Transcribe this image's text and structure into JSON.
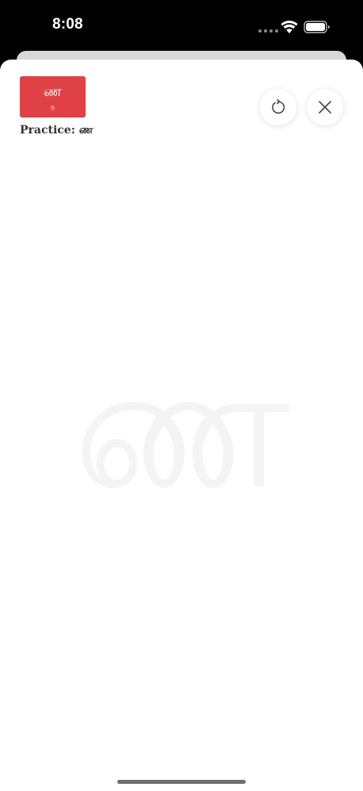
{
  "status_bar": {
    "time": "8:08",
    "icons": [
      "signal-dots-icon",
      "wifi-icon",
      "battery-icon"
    ]
  },
  "letter_card": {
    "letter": "ண",
    "transliteration": "ṇ"
  },
  "practice": {
    "label": "Practice: ண"
  },
  "actions": {
    "reset_icon": "reset-icon",
    "close_icon": "close-icon"
  },
  "canvas": {
    "guide_letter": "ண"
  },
  "colors": {
    "chip_background": "#e04146",
    "label_text": "#3a3330",
    "guide_letter": "#f4f4f6",
    "sheet_background": "#ffffff",
    "status_background": "#000000"
  }
}
